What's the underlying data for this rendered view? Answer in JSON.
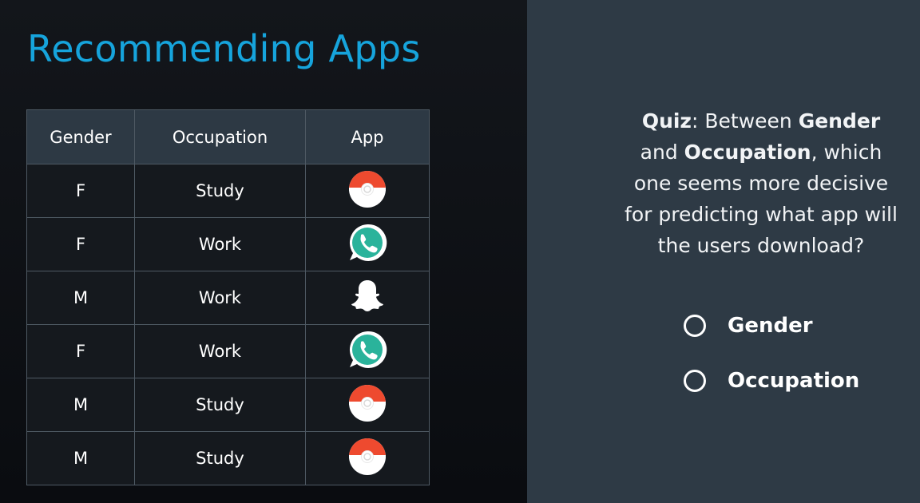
{
  "title": "Recommending Apps",
  "table": {
    "headers": [
      "Gender",
      "Occupation",
      "App"
    ],
    "rows": [
      {
        "gender": "F",
        "occupation": "Study",
        "app": "pokeball-icon"
      },
      {
        "gender": "F",
        "occupation": "Work",
        "app": "whatsapp-icon"
      },
      {
        "gender": "M",
        "occupation": "Work",
        "app": "snapchat-icon"
      },
      {
        "gender": "F",
        "occupation": "Work",
        "app": "whatsapp-icon"
      },
      {
        "gender": "M",
        "occupation": "Study",
        "app": "pokeball-icon"
      },
      {
        "gender": "M",
        "occupation": "Study",
        "app": "pokeball-icon"
      }
    ]
  },
  "quiz": {
    "label": "Quiz",
    "t1": ": Between ",
    "b1": "Gender",
    "t2": " and ",
    "b2": "Occupation",
    "t3": ", which one seems more decisive for predicting what app will the users download?"
  },
  "options": [
    "Gender",
    "Occupation"
  ],
  "colors": {
    "title": "#16a4dc",
    "female": "#6f2a41",
    "male": "#0f4c60",
    "right_panel": "#2e3a45"
  }
}
